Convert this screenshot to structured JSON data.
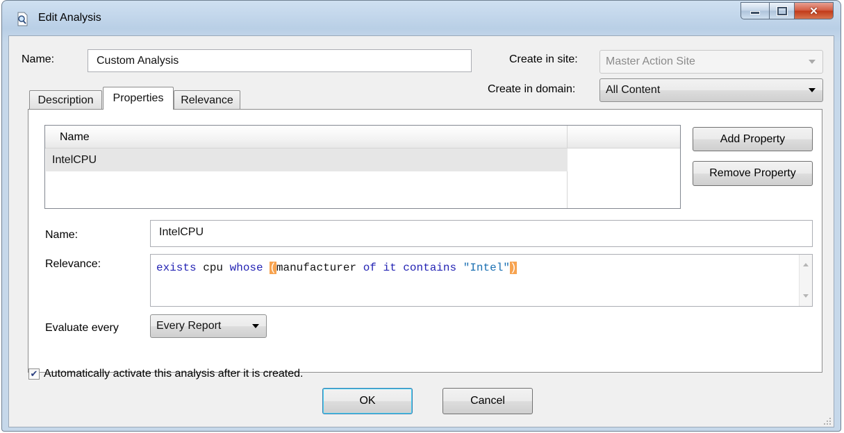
{
  "window": {
    "title": "Edit Analysis",
    "icon": "magnifier-document-icon",
    "controls": {
      "minimize": "minimize-icon",
      "maximize": "maximize-icon",
      "close": "close-icon"
    }
  },
  "form": {
    "name_label": "Name:",
    "name_value": "Custom Analysis",
    "site_label": "Create in site:",
    "site_value": "Master Action Site",
    "domain_label": "Create in domain:",
    "domain_value": "All Content"
  },
  "tabs": [
    {
      "label": "Description",
      "active": false
    },
    {
      "label": "Properties",
      "active": true
    },
    {
      "label": "Relevance",
      "active": false
    }
  ],
  "properties": {
    "column_header": "Name",
    "rows": [
      "IntelCPU"
    ],
    "add_button": "Add Property",
    "remove_button": "Remove Property",
    "name_label": "Name:",
    "name_value": "IntelCPU",
    "relevance_label": "Relevance:",
    "relevance_tokens": [
      {
        "text": "exists",
        "kind": "keyword"
      },
      {
        "text": " cpu ",
        "kind": "plain"
      },
      {
        "text": "whose",
        "kind": "keyword"
      },
      {
        "text": " ",
        "kind": "plain"
      },
      {
        "text": "(",
        "kind": "paren"
      },
      {
        "text": "manufacturer ",
        "kind": "plain"
      },
      {
        "text": "of it contains",
        "kind": "keyword"
      },
      {
        "text": " ",
        "kind": "plain"
      },
      {
        "text": "\"Intel\"",
        "kind": "string"
      },
      {
        "text": ")",
        "kind": "paren"
      }
    ],
    "evaluate_label": "Evaluate every",
    "evaluate_value": "Every Report"
  },
  "footer": {
    "auto_activate_label": "Automatically activate this analysis after it is created.",
    "auto_activate_checked": true,
    "ok_button": "OK",
    "cancel_button": "Cancel"
  },
  "colors": {
    "keyword": "#2424b4",
    "string": "#1a6fb2",
    "paren_highlight": "#f7a350",
    "close_button": "#c03918"
  }
}
